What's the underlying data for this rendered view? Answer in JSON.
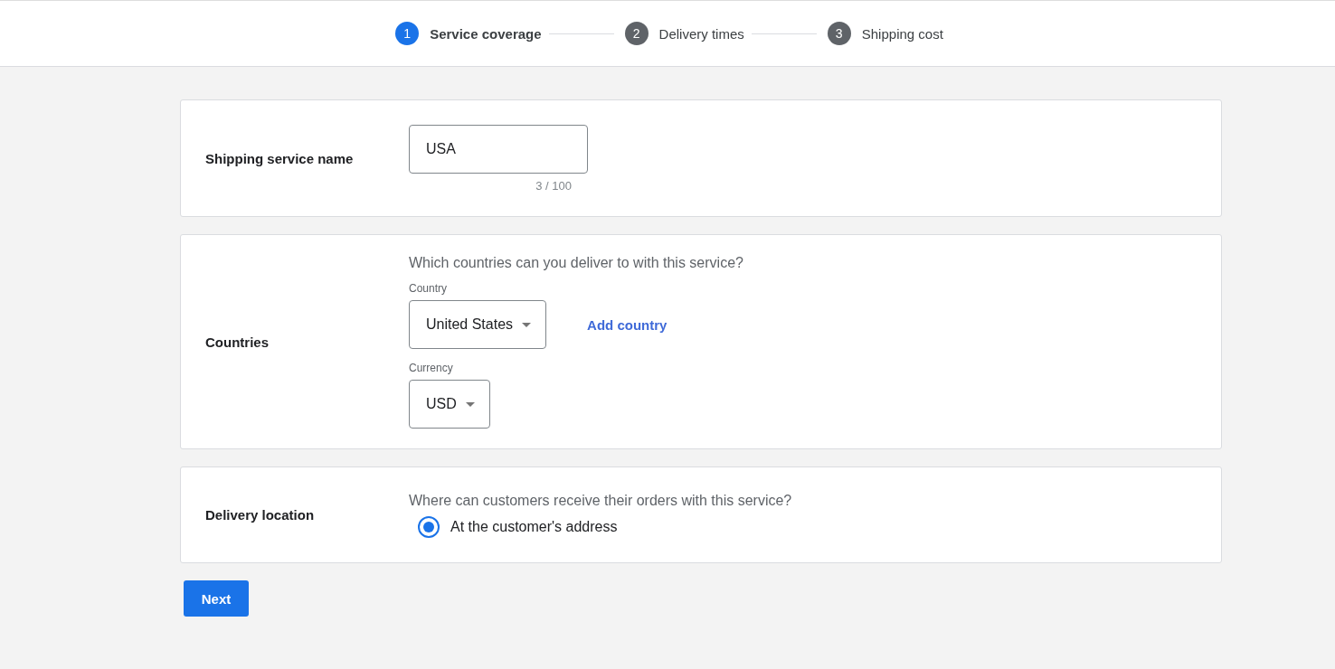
{
  "stepper": {
    "steps": [
      {
        "number": "1",
        "label": "Service coverage",
        "selected": true
      },
      {
        "number": "2",
        "label": "Delivery times",
        "selected": false
      },
      {
        "number": "3",
        "label": "Shipping cost",
        "selected": false
      }
    ]
  },
  "sections": [
    {
      "kind": "name",
      "label": "Shipping service name",
      "field": {
        "value": "USA",
        "counter": "3 / 100"
      }
    },
    {
      "kind": "countries",
      "label": "Countries",
      "question": "Which countries can you deliver to with this service?",
      "country": {
        "label": "Country",
        "value": "United States"
      },
      "add_link": "Add country",
      "currency": {
        "label": "Currency",
        "value": "USD"
      }
    },
    {
      "kind": "location",
      "label": "Delivery location",
      "question": "Where can customers receive their orders with this service?",
      "options": [
        {
          "label": "At the customer's address",
          "selected": true
        }
      ]
    }
  ],
  "next_button": "Next"
}
